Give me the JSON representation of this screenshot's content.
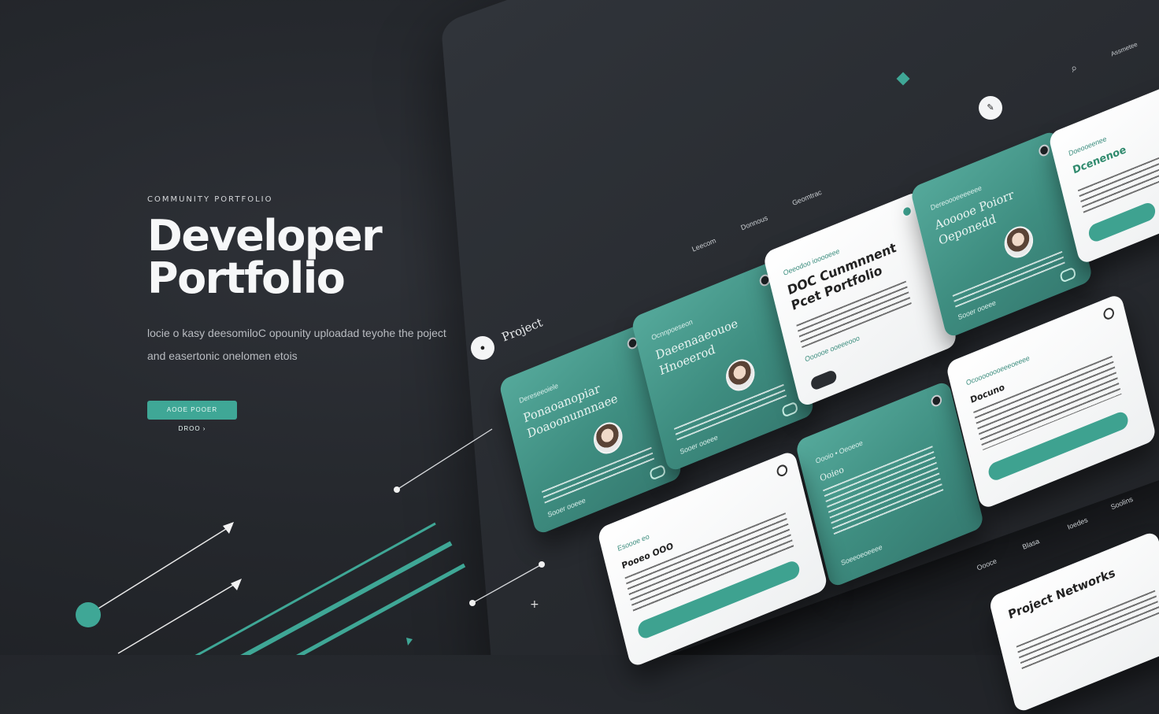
{
  "hero": {
    "eyebrow": "COMMUNITY PORTFOLIO",
    "title": "Developer Portfolio",
    "description_line1": "locie o kasy deesomiloC opounity uploadad teyohe the poject",
    "description_line2": "and easertonic onelomen etois",
    "cta_label": "AOOE POOER DROO ›"
  },
  "board": {
    "project_label": "Project",
    "nav_labels": [
      "Leecom",
      "Donnous",
      "Geomtrac"
    ],
    "right_labels": [
      "Oooce",
      "Blasa",
      "Ioedes",
      "Soolins"
    ],
    "search_icon": "search-icon",
    "top_right_label": "Assmetee"
  },
  "cards": [
    {
      "id": "c1",
      "style": "teal",
      "subtitle": "Dereseeoiele",
      "title": "Ponaoanopiar Doaoonunnnaee",
      "footer": "Sooer ooeee"
    },
    {
      "id": "c2",
      "style": "teal",
      "subtitle": "Ocnnpoeseon",
      "title": "Daeenaaeouoe Hnoeerod",
      "footer": "Sooer ooeee"
    },
    {
      "id": "c3",
      "style": "white",
      "subtitle": "Oeeodoo iooooeee",
      "title": "DOC Cunmnnent Pcet Portfolio",
      "footer": "Oooooe ooeeeooo"
    },
    {
      "id": "c4",
      "style": "teal",
      "subtitle": "Dereoooeeeeeee",
      "title": "Aooooe Poiorr Oeponedd",
      "footer": "Sooer ooeee"
    },
    {
      "id": "c5",
      "style": "white",
      "subtitle": "Doeooeenee",
      "title": "Dcenenoe",
      "footer": ""
    },
    {
      "id": "c6",
      "style": "teal",
      "subtitle": "Oooio • Oeoeoe",
      "title": "Ooieo",
      "footer": "Soeeoeoeeee"
    },
    {
      "id": "c7",
      "style": "white",
      "subtitle": "Ocoooooooeeeoeeee",
      "title": "Docuno",
      "footer": ""
    },
    {
      "id": "c8",
      "style": "white",
      "subtitle": "Esoooe eo",
      "title": "Pooeo OOO",
      "footer": ""
    },
    {
      "id": "c9",
      "style": "white",
      "subtitle": "",
      "title": "Project Networks",
      "footer": ""
    }
  ],
  "colors": {
    "background": "#25282d",
    "accent": "#3fa796",
    "board": "#2c2f34"
  }
}
